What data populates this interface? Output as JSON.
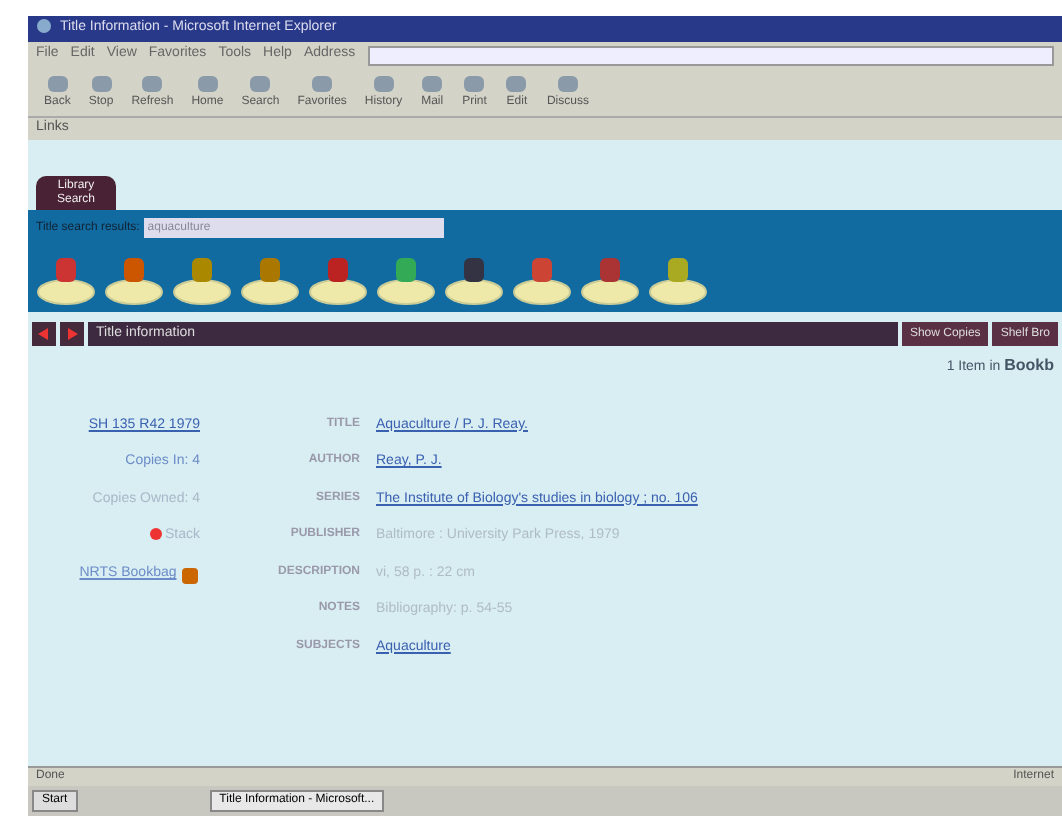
{
  "window": {
    "title": "Title Information - Microsoft Internet Explorer"
  },
  "menu": [
    "File",
    "Edit",
    "View",
    "Favorites",
    "Tools",
    "Help"
  ],
  "address": {
    "label": "Address"
  },
  "toolbar": [
    "Back",
    "Stop",
    "Refresh",
    "Home",
    "Search",
    "Favorites",
    "History",
    "Mail",
    "Print",
    "Edit",
    "Discuss"
  ],
  "links": {
    "label": "Links"
  },
  "page": {
    "tabs": [
      {
        "label": "Library Search",
        "selected": true
      }
    ],
    "search": {
      "label": "Title search results:",
      "value": "aquaculture"
    },
    "title_bar": {
      "label": "Title information",
      "buttons": [
        "Show Copies",
        "Shelf Bro"
      ]
    },
    "bookbag": {
      "text": "1 Item in",
      "link": "Bookb"
    },
    "side": [
      {
        "kind": "link",
        "text": "SH 135 R42 1979"
      },
      {
        "kind": "text",
        "text": "Copies In: 4"
      },
      {
        "kind": "muted",
        "text": "Copies Owned: 4"
      },
      {
        "kind": "status",
        "text": "Stack"
      },
      {
        "kind": "bookbag",
        "text": "NRTS Bookbag"
      }
    ],
    "fields": [
      {
        "label": "TITLE",
        "value": "Aquaculture / P. J. Reay.",
        "link": true
      },
      {
        "label": "AUTHOR",
        "value": "Reay, P. J.",
        "link": true
      },
      {
        "label": "SERIES",
        "value": "The Institute of Biology's studies in biology ; no. 106",
        "link": true
      },
      {
        "label": "PUBLISHER",
        "value": "Baltimore : University Park Press, 1979",
        "link": false
      },
      {
        "label": "DESCRIPTION",
        "value": "vi, 58 p. : 22 cm",
        "link": false
      },
      {
        "label": "NOTES",
        "value": "Bibliography: p. 54-55",
        "link": false
      },
      {
        "label": "SUBJECTS",
        "value": "Aquaculture",
        "link": true
      }
    ]
  },
  "status_bar": {
    "text": "Done",
    "zone": "Internet"
  },
  "taskbar": {
    "start": "Start",
    "task": "Title Information - Microsoft..."
  }
}
